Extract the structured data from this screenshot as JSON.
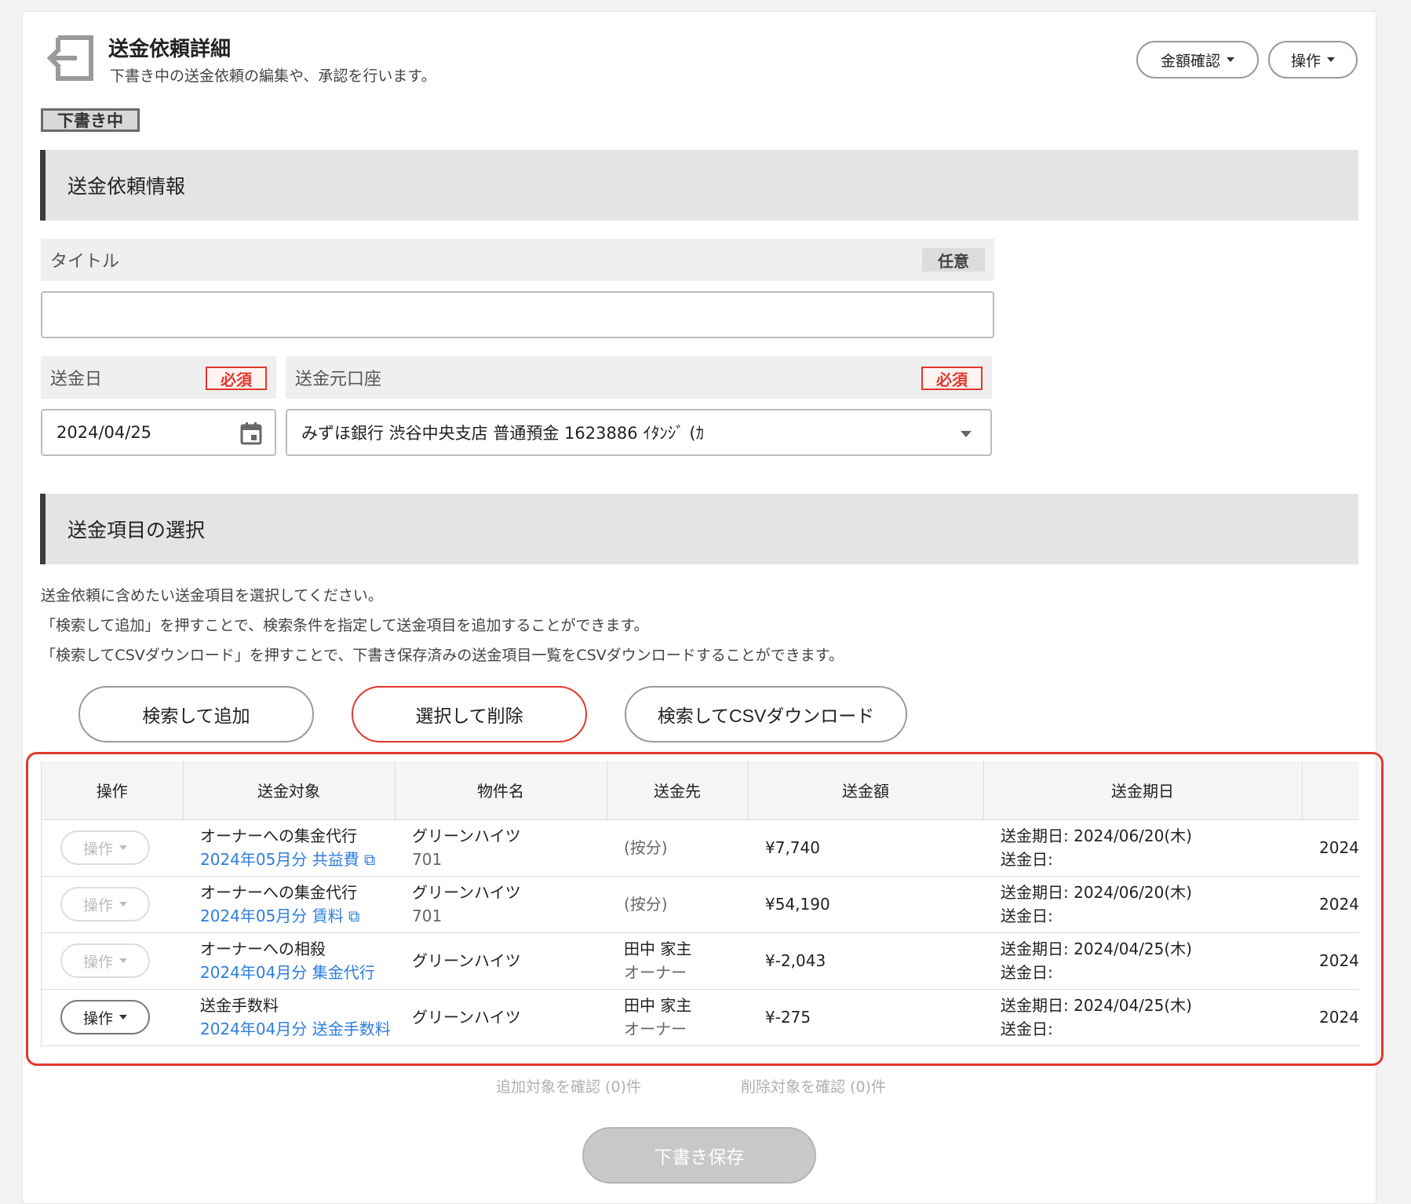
{
  "header": {
    "title": "送金依頼詳細",
    "subtitle": "下書き中の送金依頼の編集や、承認を行います。",
    "amount_check_label": "金額確認",
    "actions_label": "操作"
  },
  "status_badge": "下書き中",
  "section_info": {
    "title": "送金依頼情報"
  },
  "form": {
    "title_label": "タイトル",
    "optional": "任意",
    "title_value": "",
    "date_label": "送金日",
    "required": "必須",
    "date_value": "2024/04/25",
    "account_label": "送金元口座",
    "account_value": "みずほ銀行 渋谷中央支店 普通預金 1623886 ｲﾀﾝｼﾞ (ｶ"
  },
  "section_items": {
    "title": "送金項目の選択",
    "desc": [
      "送金依頼に含めたい送金項目を選択してください。",
      "「検索して追加」を押すことで、検索条件を指定して送金項目を追加することができます。",
      "「検索してCSVダウンロード」を押すことで、下書き保存済みの送金項目一覧をCSVダウンロードすることができます。"
    ],
    "search_add": "検索して追加",
    "select_delete": "選択して削除",
    "search_csv": "検索してCSVダウンロード"
  },
  "table": {
    "columns": [
      "操作",
      "送金対象",
      "物件名",
      "送金先",
      "送金額",
      "送金期日",
      ""
    ],
    "rows": [
      {
        "op": "操作",
        "target": "オーナーへの集金代行",
        "target_link": "2024年05月分 共益費 ⧉",
        "property": "グリーンハイツ",
        "property_sub": "701",
        "dest": "(按分)",
        "dest_sub": "",
        "amount": "¥7,740",
        "due": "送金期日: 2024/06/20(木)",
        "due_sub": "送金日:",
        "extra": "2024"
      },
      {
        "op": "操作",
        "target": "オーナーへの集金代行",
        "target_link": "2024年05月分 賃料 ⧉",
        "property": "グリーンハイツ",
        "property_sub": "701",
        "dest": "(按分)",
        "dest_sub": "",
        "amount": "¥54,190",
        "due": "送金期日: 2024/06/20(木)",
        "due_sub": "送金日:",
        "extra": "2024"
      },
      {
        "op": "操作",
        "target": "オーナーへの相殺",
        "target_link": "2024年04月分 集金代行",
        "property": "グリーンハイツ",
        "property_sub": "",
        "dest": "田中 家主",
        "dest_sub": "オーナー",
        "amount": "¥-2,043",
        "due": "送金期日: 2024/04/25(木)",
        "due_sub": "送金日:",
        "extra": "2024"
      },
      {
        "op": "操作",
        "target": "送金手数料",
        "target_link": "2024年04月分 送金手数料",
        "property": "グリーンハイツ",
        "property_sub": "",
        "dest": "田中 家主",
        "dest_sub": "オーナー",
        "amount": "¥-275",
        "due": "送金期日: 2024/04/25(木)",
        "due_sub": "送金日:",
        "extra": "2024"
      }
    ]
  },
  "confirm_add": "追加対象を確認 (0)件",
  "confirm_delete": "削除対象を確認 (0)件",
  "save_draft": "下書き保存"
}
